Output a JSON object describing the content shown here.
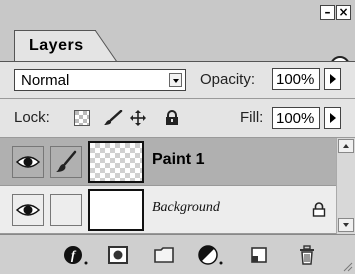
{
  "panel": {
    "tab_label": "Layers"
  },
  "options": {
    "blend_mode": "Normal",
    "opacity_label": "Opacity:",
    "opacity_value": "100%",
    "lock_label": "Lock:",
    "fill_label": "Fill:",
    "fill_value": "100%"
  },
  "layers": [
    {
      "name": "Paint 1",
      "selected": true,
      "visible": true,
      "locked": false
    },
    {
      "name": "Background",
      "selected": false,
      "visible": true,
      "locked": true
    }
  ],
  "colors": {
    "selected_row": "#b0b0b0",
    "panel_bg": "#e4e4e4"
  },
  "icons": {
    "lock_options": [
      "lock-transparent-icon",
      "lock-image-icon",
      "lock-position-icon",
      "lock-all-icon"
    ],
    "bottom_toolbar": [
      "layer-style-icon",
      "layer-mask-icon",
      "new-group-icon",
      "adjustment-layer-icon",
      "new-layer-icon",
      "trash-icon"
    ]
  }
}
